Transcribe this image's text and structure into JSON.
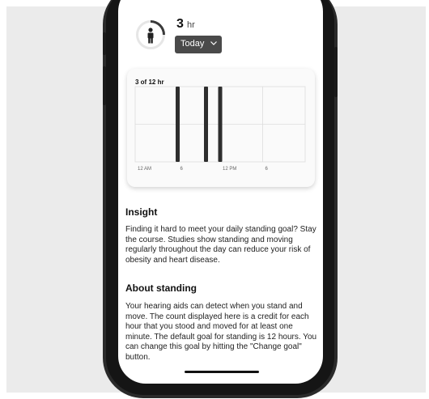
{
  "summary": {
    "value": "3",
    "unit": "hr",
    "progress_fraction": 0.25,
    "period_dropdown": "Today",
    "icon": "person-standing-icon"
  },
  "chart_data": {
    "type": "bar",
    "title": "3 of 12 hr",
    "x_ticks": [
      {
        "hour": 0,
        "label": "12 AM"
      },
      {
        "hour": 6,
        "label": "6"
      },
      {
        "hour": 12,
        "label": "12 PM"
      },
      {
        "hour": 18,
        "label": "6"
      }
    ],
    "xlim": [
      0,
      24
    ],
    "ylim": [
      0,
      1
    ],
    "bars": [
      {
        "hour": 6,
        "value": 1
      },
      {
        "hour": 10,
        "value": 1
      },
      {
        "hour": 12,
        "value": 1
      }
    ],
    "grid": true
  },
  "insight": {
    "heading": "Insight",
    "body": "Finding it hard to meet your daily standing goal? Stay the course. Studies show standing and moving regularly throughout the day can reduce your risk of obesity and heart disease."
  },
  "about": {
    "heading": "About standing",
    "body": "Your hearing aids can detect when you stand and move. The count displayed here is a credit for each hour that you stood and moved for at least one minute. The default goal for standing is 12 hours. You can change this goal by hitting the \"Change goal\" button."
  },
  "colors": {
    "ring_track": "#e6e6e6",
    "ring_progress": "#3a3a3a",
    "bar": "#2e2e2e",
    "grid": "#dddddd"
  }
}
